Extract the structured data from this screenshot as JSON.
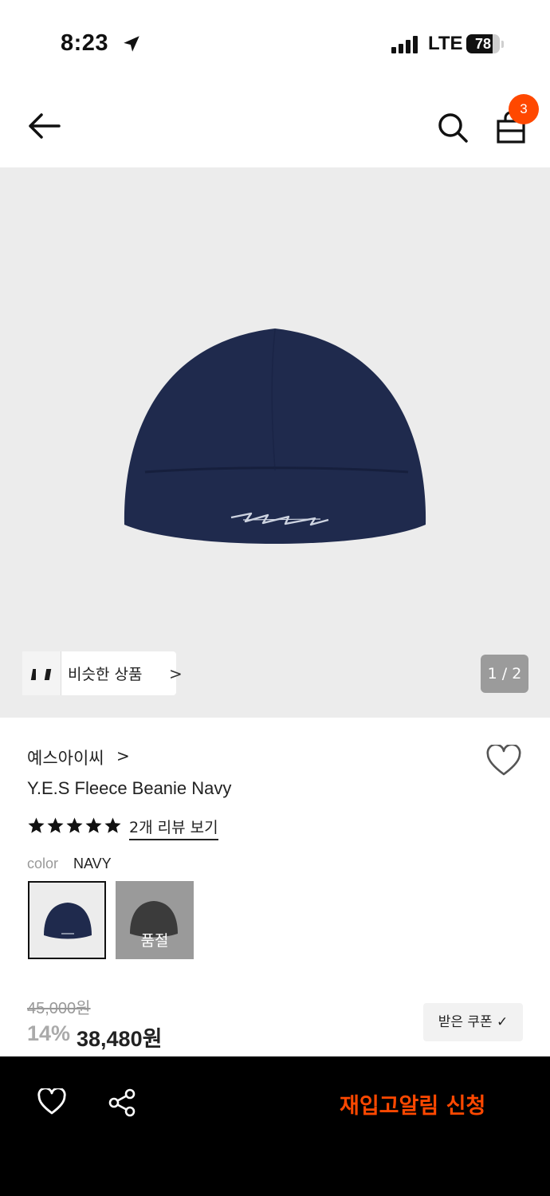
{
  "status": {
    "time": "8:23",
    "network": "LTE",
    "battery_level": 78,
    "battery": "78"
  },
  "nav": {
    "cart_count": "3"
  },
  "gallery": {
    "similar_label": "비슷한 상품",
    "similar_chevron": ">",
    "page_counter": "1 / 2"
  },
  "product": {
    "brand": "예스아이씨",
    "brand_chevron": ">",
    "name": "Y.E.S Fleece Beanie Navy",
    "rating": 5,
    "review_link": "2개 리뷰 보기",
    "color_label": "color",
    "color_value": "NAVY",
    "swatches": [
      {
        "color": "#1f2a4d",
        "sold_out_label": ""
      },
      {
        "color": "#3b3b3b",
        "sold_out_label": "품절"
      }
    ],
    "original_price": "45,000원",
    "discount": "14%",
    "sale_price": "38,480원",
    "coupon_label": "받은 쿠폰 ✓"
  },
  "bottom_bar": {
    "restock_label": "재입고알림 신청"
  },
  "colors": {
    "accent": "#ff4800",
    "hero_bg": "#ececec",
    "beanie_navy": "#1f2a4d"
  }
}
